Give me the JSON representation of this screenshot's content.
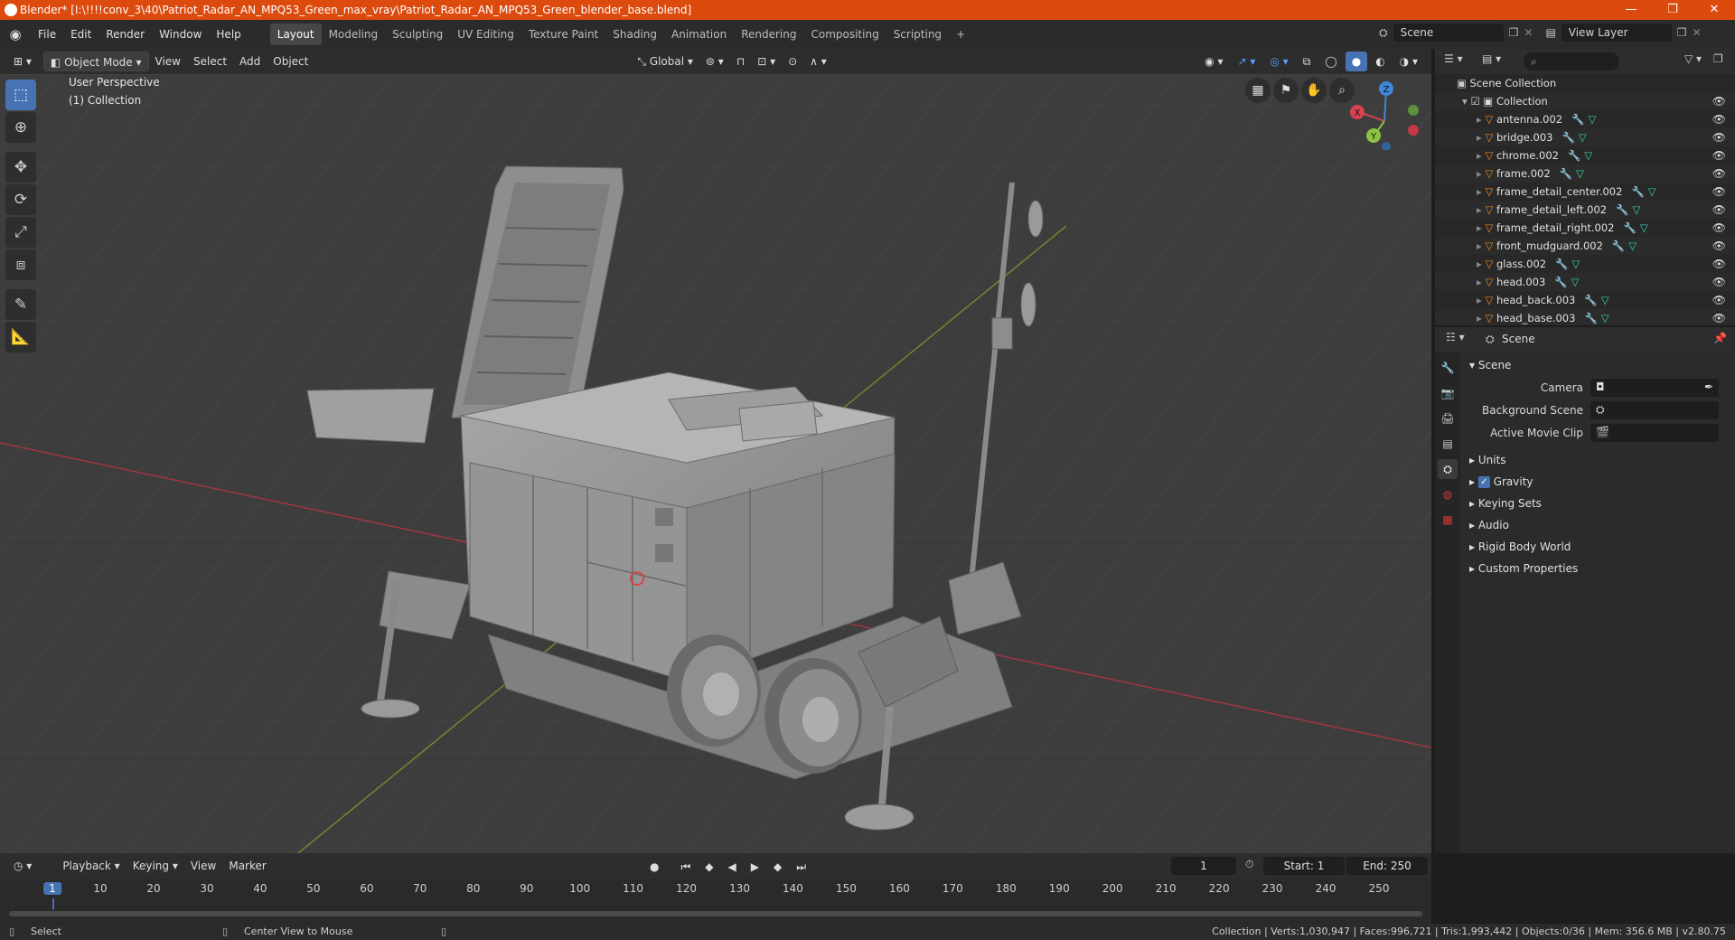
{
  "window": {
    "title": "Blender* [I:\\!!!!conv_3\\40\\Patriot_Radar_AN_MPQ53_Green_max_vray\\Patriot_Radar_AN_MPQ53_Green_blender_base.blend]",
    "minimize": "—",
    "maximize": "❐",
    "close": "✕"
  },
  "menu": [
    "File",
    "Edit",
    "Render",
    "Window",
    "Help"
  ],
  "workspaces": [
    "Layout",
    "Modeling",
    "Sculpting",
    "UV Editing",
    "Texture Paint",
    "Shading",
    "Animation",
    "Rendering",
    "Compositing",
    "Scripting"
  ],
  "workspace_add": "+",
  "scene_field": "Scene",
  "view_layer_field": "View Layer",
  "viewport": {
    "mode": "Object Mode",
    "menus": [
      "View",
      "Select",
      "Add",
      "Object"
    ],
    "orientation": "Global",
    "perspective_label": "User Perspective",
    "collection_label": "(1) Collection",
    "gizmo_axes": {
      "x": "X",
      "y": "Y",
      "z": "Z"
    }
  },
  "tools": [
    "select-box-icon",
    "cursor-icon",
    "move-icon",
    "rotate-icon",
    "scale-icon",
    "transform-icon",
    "annotate-icon",
    "measure-icon"
  ],
  "outliner": {
    "search_placeholder": "",
    "root": "Scene Collection",
    "collection": "Collection",
    "items": [
      "antenna.002",
      "bridge.003",
      "chrome.002",
      "frame.002",
      "frame_detail_center.002",
      "frame_detail_left.002",
      "frame_detail_right.002",
      "front_mudguard.002",
      "glass.002",
      "head.003",
      "head_back.003",
      "head_base.003"
    ]
  },
  "properties": {
    "context_title": "Scene",
    "section_scene": "Scene",
    "camera_label": "Camera",
    "background_scene_label": "Background Scene",
    "active_movie_clip_label": "Active Movie Clip",
    "subsections": [
      "Units",
      "Gravity",
      "Keying Sets",
      "Audio",
      "Rigid Body World",
      "Custom Properties"
    ],
    "gravity_checked": true
  },
  "timeline": {
    "menus": [
      "Playback",
      "Keying",
      "View",
      "Marker"
    ],
    "current_frame": "1",
    "start_label": "Start:",
    "start": "1",
    "end_label": "End:",
    "end": "250",
    "ticks": [
      "1",
      "10",
      "20",
      "30",
      "40",
      "50",
      "60",
      "70",
      "80",
      "90",
      "100",
      "110",
      "120",
      "130",
      "140",
      "150",
      "160",
      "170",
      "180",
      "190",
      "200",
      "210",
      "220",
      "230",
      "240",
      "250"
    ]
  },
  "status": {
    "left_select": "Select",
    "center_view": "Center View to Mouse",
    "stats": "Collection | Verts:1,030,947 | Faces:996,721 | Tris:1,993,442 | Objects:0/36 | Mem: 356.6 MB | v2.80.75"
  },
  "colors": {
    "titlebar": "#dc4a0d",
    "accent": "#4772b3",
    "x_axis": "#d8434f",
    "y_axis": "#8ac441",
    "z_axis": "#3f87d6",
    "object_icon": "#e78a2c",
    "mesh_icon": "#33d6a7"
  }
}
